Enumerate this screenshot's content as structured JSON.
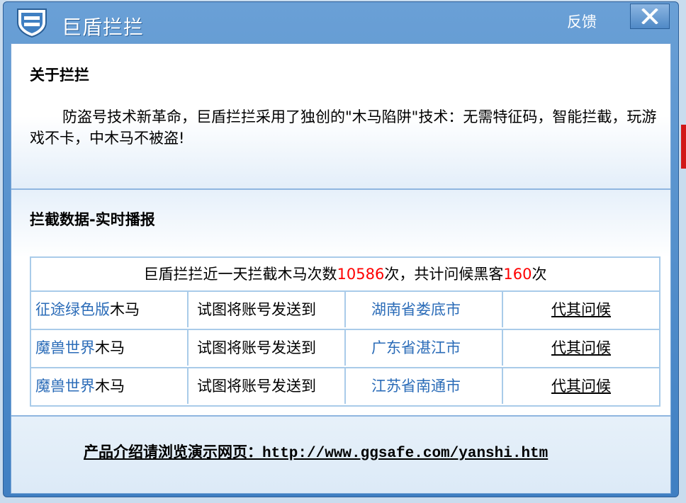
{
  "window": {
    "title": "巨盾拦拦",
    "feedback_label": "反馈",
    "close_icon": "close-icon",
    "app_icon": "shield-icon",
    "accent_color": "#3f7fc2"
  },
  "about": {
    "heading": "关于拦拦",
    "text": "防盗号技术新革命，巨盾拦拦采用了独创的\"木马陷阱\"技术：无需特征码，智能拦截，玩游戏不卡，中木马不被盗!"
  },
  "data_section": {
    "heading": "拦截数据-实时播报",
    "summary": {
      "prefix": "巨盾拦拦近一天拦截木马次数",
      "blocked_count": "10586",
      "middle": "次，共计问候黑客",
      "greet_count": "160",
      "suffix": "次"
    },
    "rows": [
      {
        "game": "征途绿色版",
        "trojan": "木马",
        "action": "试图将账号发送到",
        "location": "湖南省娄底市",
        "greet": "代其问候"
      },
      {
        "game": "魔兽世界",
        "trojan": "木马",
        "action": "试图将账号发送到",
        "location": "广东省湛江市",
        "greet": "代其问候"
      },
      {
        "game": "魔兽世界",
        "trojan": "木马",
        "action": "试图将账号发送到",
        "location": "江苏省南通市",
        "greet": "代其问候"
      }
    ]
  },
  "footer": {
    "label": "产品介绍请浏览演示网页：",
    "url": "http://www.ggsafe.com/yanshi.htm"
  }
}
